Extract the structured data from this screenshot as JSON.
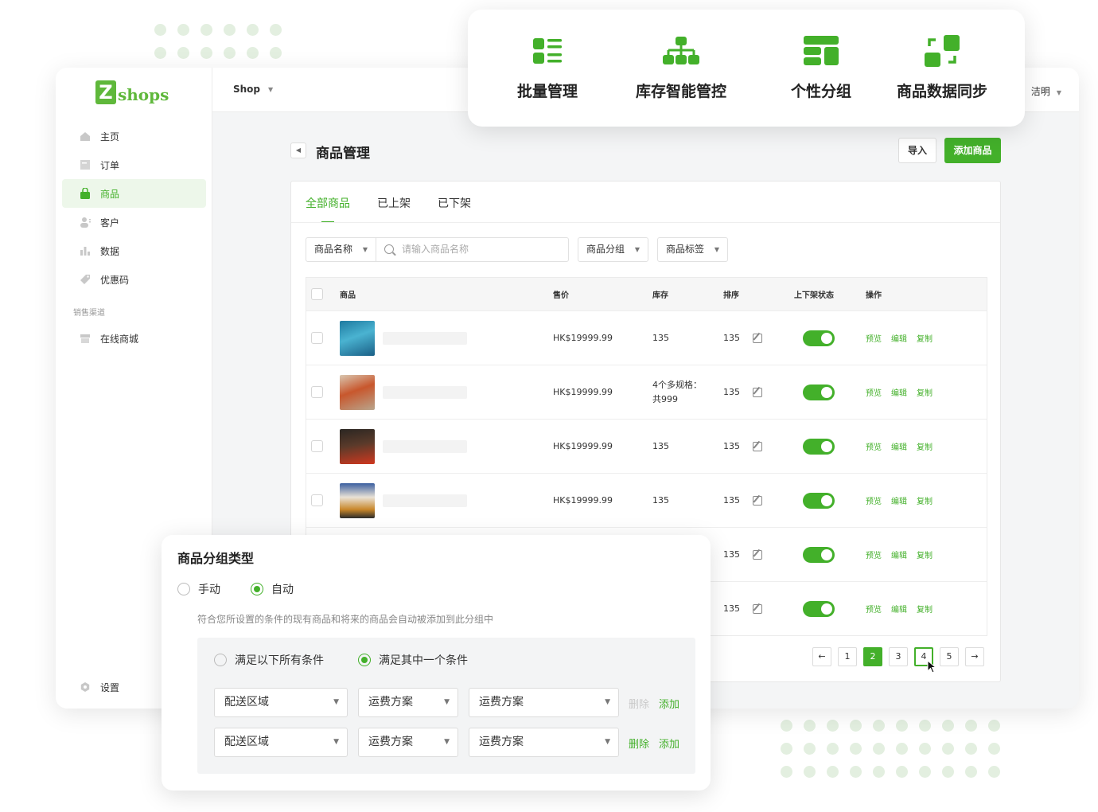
{
  "brand": {
    "logo_letter": "Z",
    "logo_text": "shops"
  },
  "topbar": {
    "shop_label": "Shop",
    "user_label": "洁明"
  },
  "sidebar": {
    "items": [
      {
        "label": "主页",
        "icon": "home-icon"
      },
      {
        "label": "订单",
        "icon": "order-icon"
      },
      {
        "label": "商品",
        "icon": "bag-icon"
      },
      {
        "label": "客户",
        "icon": "customer-icon"
      },
      {
        "label": "数据",
        "icon": "chart-icon"
      },
      {
        "label": "优惠码",
        "icon": "tag-icon"
      }
    ],
    "section_label": "销售渠道",
    "channel_item": "在线商城",
    "settings_label": "设置"
  },
  "features": [
    {
      "label": "批量管理",
      "icon": "list-grid-icon"
    },
    {
      "label": "库存智能管控",
      "icon": "hierarchy-icon"
    },
    {
      "label": "个性分组",
      "icon": "layout-group-icon"
    },
    {
      "label": "商品数据同步",
      "icon": "sync-icon"
    }
  ],
  "page": {
    "title": "商品管理",
    "import_label": "导入",
    "add_label": "添加商品",
    "tabs": [
      "全部商品",
      "已上架",
      "已下架"
    ],
    "filters": {
      "name_select": "商品名称",
      "search_placeholder": "请输入商品名称",
      "group_select": "商品分组",
      "tag_select": "商品标签"
    },
    "columns": [
      "商品",
      "售价",
      "库存",
      "排序",
      "上下架状态",
      "操作"
    ],
    "rows": [
      {
        "price": "HK$19999.99",
        "stock": "135",
        "sort": "135"
      },
      {
        "price": "HK$19999.99",
        "stock": "4个多规格：",
        "stock2": "共999",
        "sort": "135"
      },
      {
        "price": "HK$19999.99",
        "stock": "135",
        "sort": "135"
      },
      {
        "price": "HK$19999.99",
        "stock": "135",
        "sort": "135"
      },
      {
        "sort": "135"
      },
      {
        "sort": "135"
      }
    ],
    "ops": {
      "preview": "预览",
      "edit": "编辑",
      "copy": "复制"
    },
    "pager": [
      "1",
      "2",
      "3",
      "4",
      "5"
    ]
  },
  "popup": {
    "title": "商品分组类型",
    "manual": "手动",
    "auto": "自动",
    "hint": "符合您所设置的条件的现有商品和将来的商品会自动被添加到此分组中",
    "match_all": "满足以下所有条件",
    "match_any": "满足其中一个条件",
    "rows": [
      {
        "field": "配送区域",
        "op": "运费方案",
        "value": "运费方案",
        "delete": "删除",
        "add": "添加"
      },
      {
        "field": "配送区域",
        "op": "运费方案",
        "value": "运费方案",
        "delete": "删除",
        "add": "添加"
      }
    ]
  },
  "colors": {
    "accent": "#43b02a",
    "sidebar_active_bg": "#edf7ea"
  }
}
